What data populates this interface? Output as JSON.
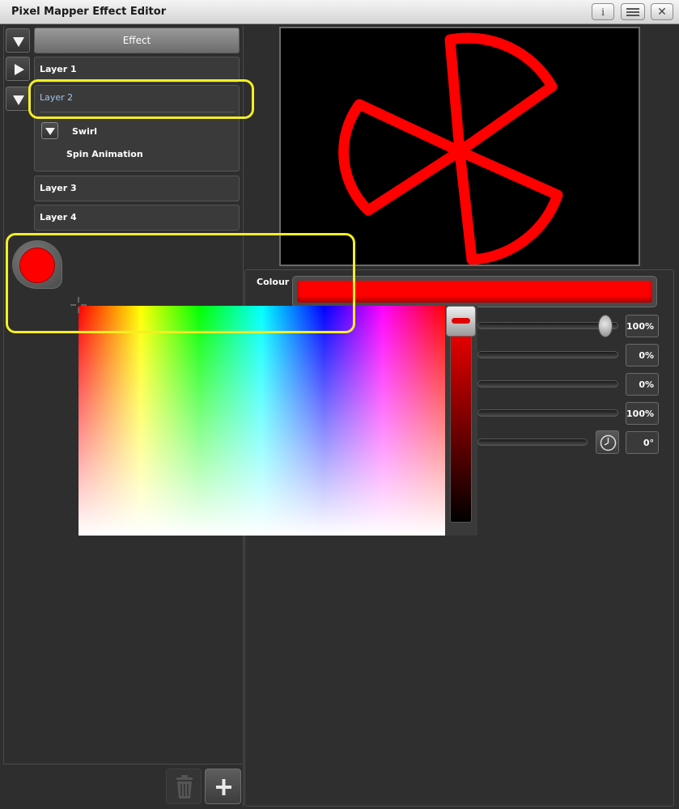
{
  "window": {
    "title": "Pixel Mapper Effect Editor",
    "info_glyph": "i",
    "close_glyph": "✕"
  },
  "tree": {
    "effect_label": "Effect",
    "layers": [
      {
        "label": "Layer 1",
        "expanded": false
      },
      {
        "label": "Layer 2",
        "expanded": true,
        "selected": true
      },
      {
        "label": "Layer 3"
      },
      {
        "label": "Layer 4"
      }
    ],
    "layer2_children": {
      "group_label": "Swirl",
      "item_label": "Spin Animation"
    }
  },
  "colour_swatch": {
    "color": "#ff0000"
  },
  "properties": {
    "colour_label": "Colour",
    "colour_value": "#ff0000",
    "sliders": [
      {
        "value": "100%",
        "level": 1.0
      },
      {
        "value": "0%",
        "level": 0.0
      },
      {
        "value": "0%",
        "level": 0.0
      },
      {
        "value": "100%",
        "level": 1.0
      },
      {
        "value": "0°",
        "level": 0.0
      }
    ]
  },
  "picker": {
    "brightness_level": 1.0
  },
  "buttons": {
    "add_glyph": "+"
  },
  "colors": {
    "highlight": "#f5ef22",
    "effect_red": "#ff0000",
    "selected_text": "#9ec6ee"
  },
  "icons": [
    "info-icon",
    "menu-icon",
    "close-icon",
    "collapse-arrow-icon",
    "expand-arrow-icon",
    "trash-icon",
    "plus-icon",
    "clock-icon",
    "crosshair-icon"
  ]
}
